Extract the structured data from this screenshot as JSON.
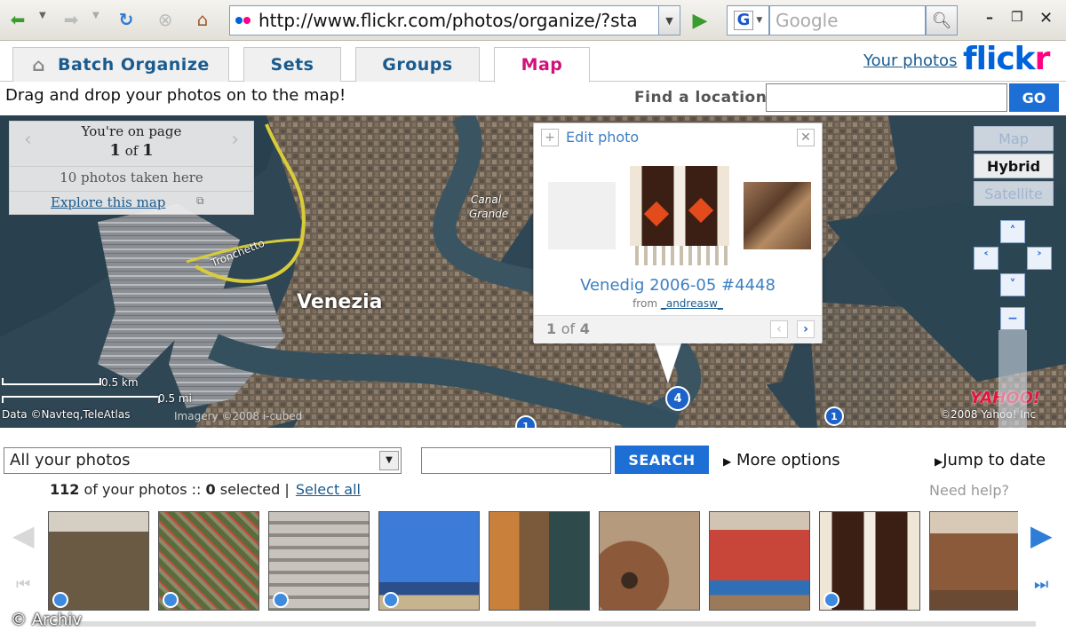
{
  "browser": {
    "url": "http://www.flickr.com/photos/organize/?sta",
    "search_placeholder": "Google",
    "search_engine_letter": "G"
  },
  "tabs": [
    {
      "label": "Batch Organize",
      "active": false
    },
    {
      "label": "Sets",
      "active": false
    },
    {
      "label": "Groups",
      "active": false
    },
    {
      "label": "Map",
      "active": true
    }
  ],
  "header": {
    "your_photos": "Your photos",
    "logo_prefix": "flick",
    "logo_suffix": "r",
    "instruction": "Drag and drop your photos on to the map!",
    "find_location_label": "Find a location",
    "go_label": "GO"
  },
  "map": {
    "page_box": {
      "line1": "You're on page",
      "page_current": "1",
      "page_of": "of",
      "page_total": "1",
      "photos_here": "10 photos taken here",
      "explore": "Explore this map"
    },
    "map_types": [
      {
        "label": "Map",
        "selected": false
      },
      {
        "label": "Hybrid",
        "selected": true
      },
      {
        "label": "Satellite",
        "selected": false
      }
    ],
    "labels": {
      "venezia": "Venezia",
      "canal_grande_1": "Canal",
      "canal_grande_2": "Grande",
      "tronchetto": "Tronchetto"
    },
    "scale_km": "0.5 km",
    "scale_mi": "0.5 mi",
    "data_credit": "Data ©Navteq,TeleAtlas",
    "imagery_credit": "Imagery ©2008 i-cubed",
    "yahoo_credit": "©2008 Yahoo! Inc",
    "yahoo_logo": "YAHOO!",
    "markers": [
      "4",
      "1",
      "1"
    ]
  },
  "popup": {
    "edit_photo": "Edit photo",
    "title": "Venedig 2006-05 #4448",
    "from_label": "from",
    "author": "_andreasw_",
    "counter_current": "1",
    "counter_of": "of",
    "counter_total": "4"
  },
  "toolbar": {
    "filter_value": "All your photos",
    "search_label": "SEARCH",
    "more_options": "More options",
    "jump_to_date": "Jump to date",
    "photo_count": "112",
    "count_text": "of your photos ::",
    "selected_count": "0",
    "selected_text": "selected |",
    "select_all": "Select all",
    "need_help": "Need help?"
  },
  "watermark": "© Archiv",
  "colors": {
    "accent_blue": "#1d6fd6",
    "flickr_blue": "#0063dc",
    "flickr_pink": "#ff0084",
    "active_tab": "#d1117a"
  }
}
